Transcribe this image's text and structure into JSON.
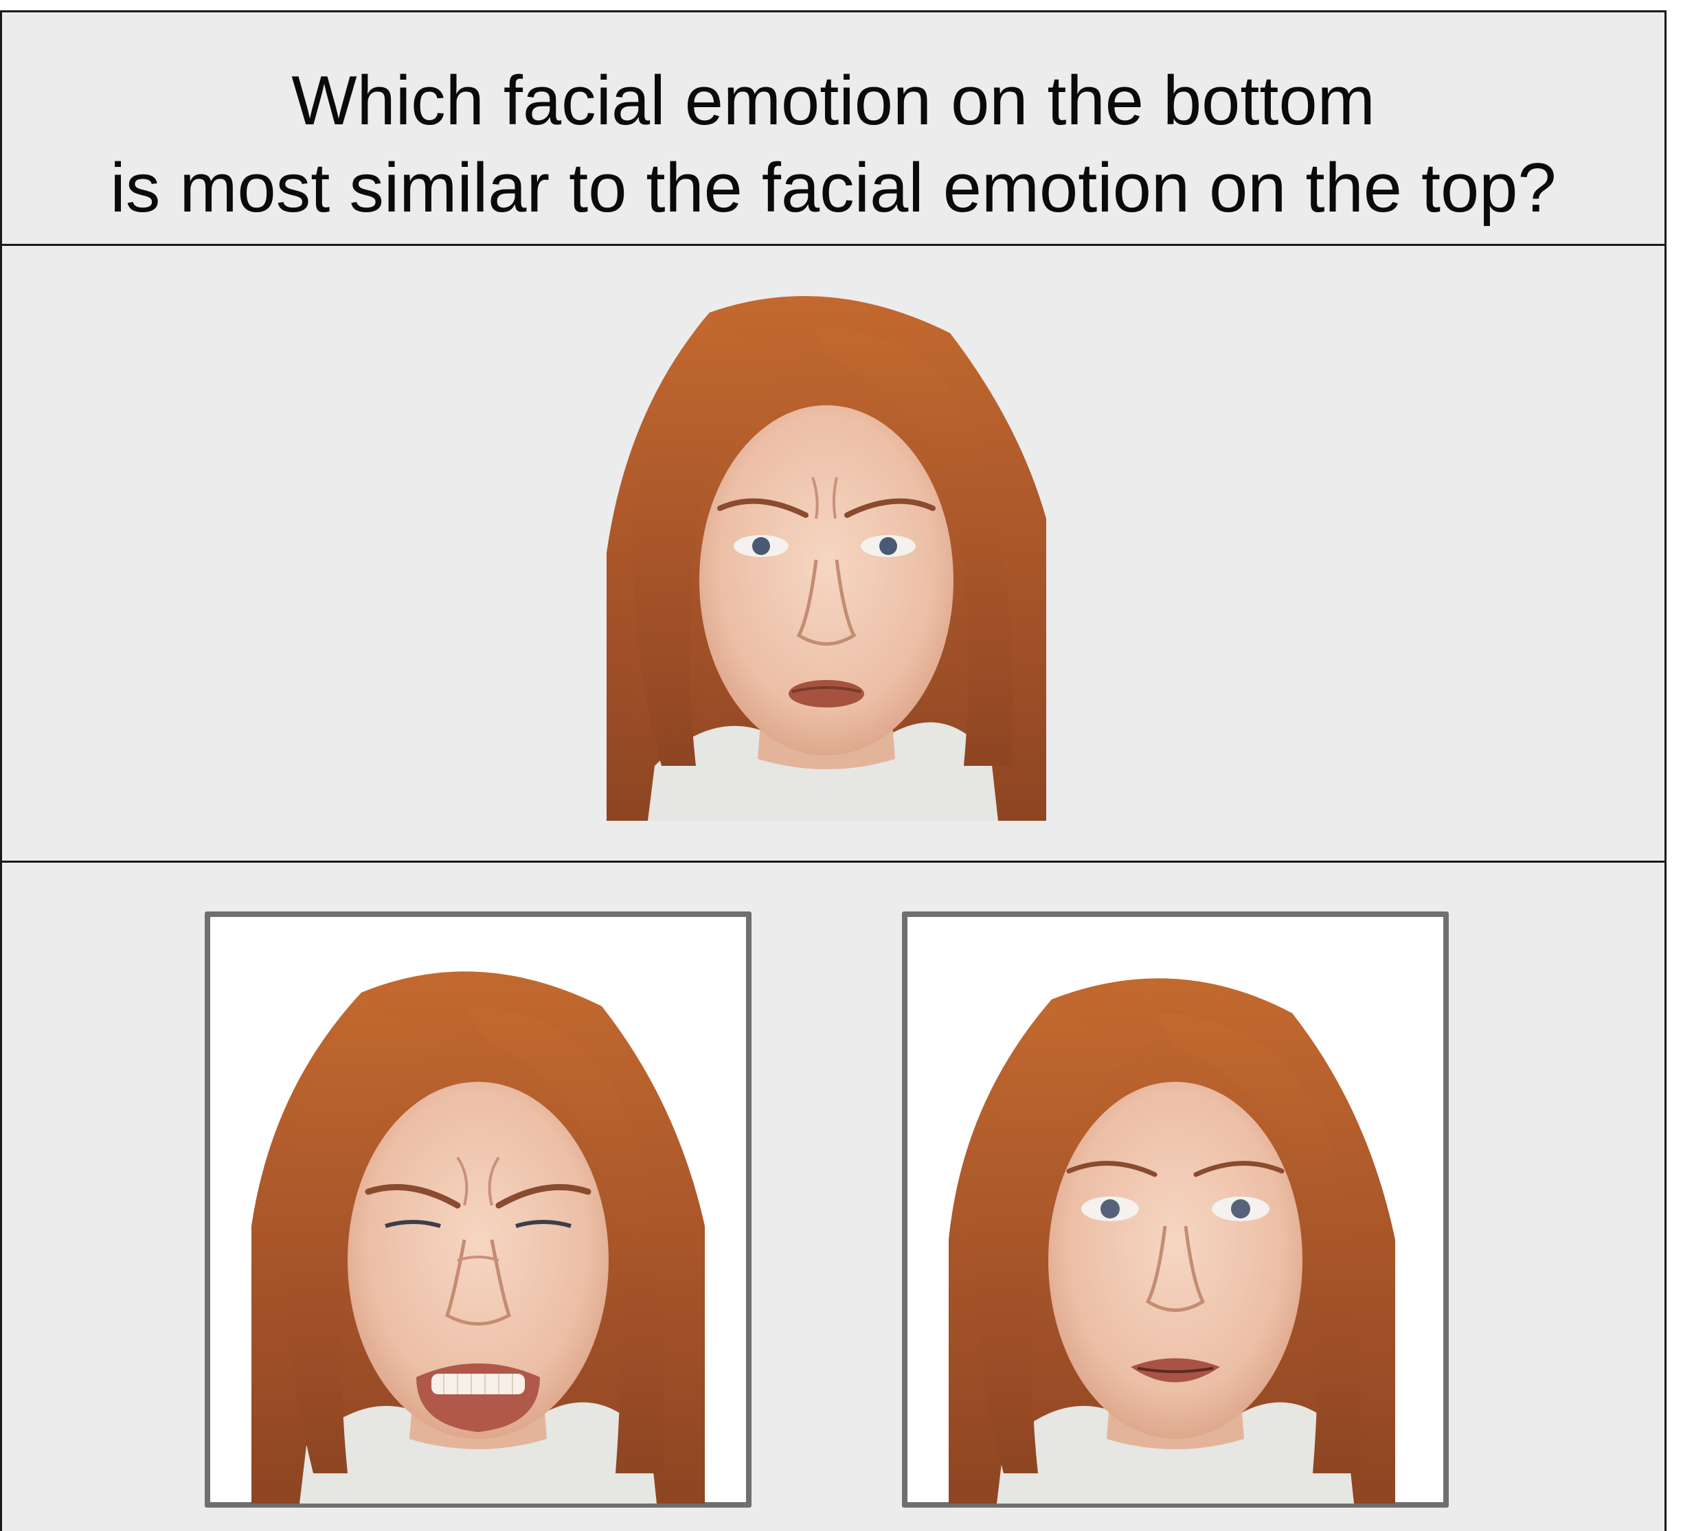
{
  "question": {
    "line1": "Which facial emotion on the bottom",
    "line2": "is most similar to the facial emotion on the top?"
  },
  "target": {
    "expression": "angry-pout"
  },
  "options": [
    {
      "expression": "angry-snarl"
    },
    {
      "expression": "neutral-surprise"
    }
  ],
  "colors": {
    "background": "#ececec",
    "border": "#1a1a1a",
    "card_border": "#6f6f6f",
    "card_fill": "#ffffff",
    "hair": "#b8622c",
    "skin": "#efc7b0",
    "collar": "#e6e6e3"
  }
}
